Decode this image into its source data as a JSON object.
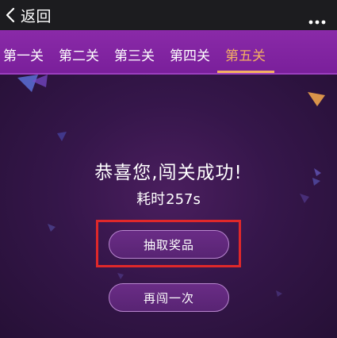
{
  "header": {
    "back_label": "返回",
    "icons": {
      "back": "chevron-left-icon",
      "more": "more-dots-icon"
    }
  },
  "level_tabs": {
    "items": [
      {
        "label": "第一关",
        "active": false
      },
      {
        "label": "第二关",
        "active": false
      },
      {
        "label": "第三关",
        "active": false
      },
      {
        "label": "第四关",
        "active": false
      },
      {
        "label": "第五关",
        "active": true
      }
    ]
  },
  "result": {
    "title": "恭喜您,闯关成功!",
    "time_label": "耗时",
    "time_value": "257s"
  },
  "actions": {
    "draw_prize_label": "抽取奖品",
    "retry_label": "再闯一次"
  },
  "colors": {
    "active_tab": "#f3b062",
    "tab_bar": "#8a2aa8",
    "highlight": "#e0282a",
    "background": "#35164a"
  }
}
